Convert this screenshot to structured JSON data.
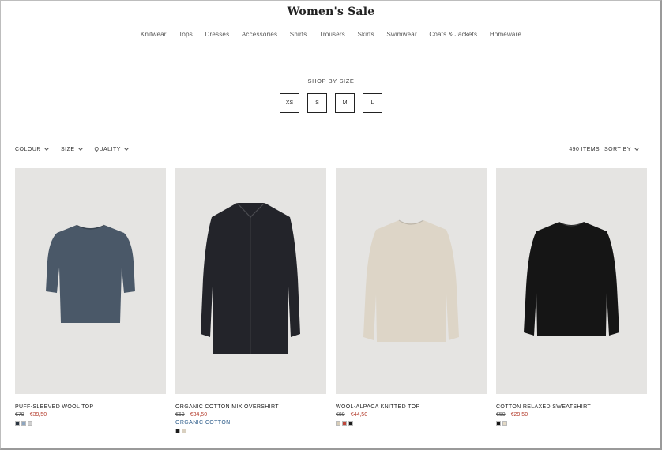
{
  "header": {
    "title": "Women's Sale"
  },
  "categories": [
    "Knitwear",
    "Tops",
    "Dresses",
    "Accessories",
    "Shirts",
    "Trousers",
    "Skirts",
    "Swimwear",
    "Coats & Jackets",
    "Homeware"
  ],
  "shop_by_size": {
    "label": "SHOP BY SIZE",
    "sizes": [
      "XS",
      "S",
      "M",
      "L"
    ]
  },
  "filters": {
    "colour": "COLOUR",
    "size": "SIZE",
    "quality": "QUALITY"
  },
  "toolbar": {
    "items_count": "490 ITEMS",
    "sort_label": "SORT BY"
  },
  "products": [
    {
      "name": "PUFF-SLEEVED WOOL TOP",
      "old_price": "€79",
      "new_price": "€39,50",
      "tag": "",
      "garment_color": "#4a5868",
      "swatches": [
        "#2a3440",
        "#8ea6c0",
        "#cfcfcf"
      ]
    },
    {
      "name": "ORGANIC COTTON MIX OVERSHIRT",
      "old_price": "€69",
      "new_price": "€34,50",
      "tag": "ORGANIC COTTON",
      "garment_color": "#23242a",
      "swatches": [
        "#1c1c1c",
        "#d9d0c0"
      ]
    },
    {
      "name": "WOOL-ALPACA KNITTED TOP",
      "old_price": "€89",
      "new_price": "€44,50",
      "tag": "",
      "garment_color": "#ddd5c7",
      "swatches": [
        "#d8cdb8",
        "#c0463a",
        "#1c1c1c"
      ]
    },
    {
      "name": "COTTON RELAXED SWEATSHIRT",
      "old_price": "€59",
      "new_price": "€29,50",
      "tag": "",
      "garment_color": "#151515",
      "swatches": [
        "#151515",
        "#e3d9c6"
      ]
    }
  ]
}
